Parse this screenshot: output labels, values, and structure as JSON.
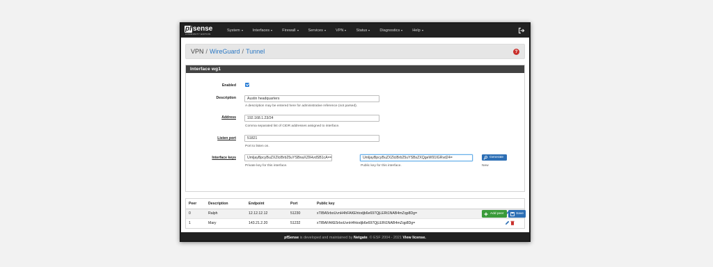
{
  "brand": {
    "name_pf": "pf",
    "name_sense": "sense",
    "edition": "COMMUNITY EDITION"
  },
  "nav": [
    "System",
    "Interfaces",
    "Firewall",
    "Services",
    "VPN",
    "Status",
    "Diagnostics",
    "Help"
  ],
  "breadcrumb": {
    "part1": "VPN",
    "part2": "WireGuard",
    "part3": "Tunnel"
  },
  "panel_title": "Interface wg1",
  "form": {
    "enabled_label": "Enabled",
    "description_label": "Description",
    "description_value": "Austin headquarters",
    "description_help": "A description may be entered here for administrative reference (not parsed).",
    "address_label": "Address",
    "address_value": "192.168.1.23/24",
    "address_help": "Comma separated list of CIDR addresses assigned to interface.",
    "listen_port_label": "Listen port",
    "listen_port_value": "51821",
    "listen_port_help": "Port to listen on.",
    "keys_label": "Interface keys",
    "private_key_value": "UmljayBpcyBuZXZlciBrb25uYSBnaXZlIHvdSB1cA==",
    "private_key_help": "Private key for this interface.",
    "public_key_value": "UmljayBpcyBuZXZlciBrb25uYSBsZXQgeW91IGRvd24=",
    "public_key_help": "Public key for this interface.",
    "generate_label": "Generate",
    "new_label": "New"
  },
  "peers": {
    "headers": [
      "Peer",
      "Description",
      "Endpoint",
      "Port",
      "Public key"
    ],
    "rows": [
      {
        "peer": "0",
        "description": "Ralph",
        "endpoint": "12.12.12.12",
        "port": "51230",
        "public_key": "xTIBA5rboUvnH4hFAKEhtodjb6e697QjLERt1NAB4mZqp8Dg="
      },
      {
        "peer": "1",
        "description": "Mary",
        "endpoint": "143.21.2.20",
        "port": "51232",
        "public_key": "xTIBAFAKE5rboUvnH4htodjb6e697QjLERt1NAB4mZqp8Dg="
      }
    ]
  },
  "buttons": {
    "add_peer": "Add peer",
    "save": "Save"
  },
  "footer": {
    "brand": "pfSense",
    "text1": " is developed and maintained by ",
    "netgate": "Netgate",
    "text2": ". © ESF 2004 - 2021 ",
    "license": "View license."
  },
  "colors": {
    "primary": "#2d6fb5",
    "success": "#3a9a3a",
    "danger": "#c9302c",
    "navbar": "#212121",
    "link": "#2b78c4"
  },
  "icons": {
    "logout": "sign-out-icon",
    "help": "question-circle-icon",
    "edit": "pencil-icon",
    "delete": "trash-icon",
    "add": "plus-icon",
    "save": "floppy-icon",
    "generate": "key-icon"
  }
}
